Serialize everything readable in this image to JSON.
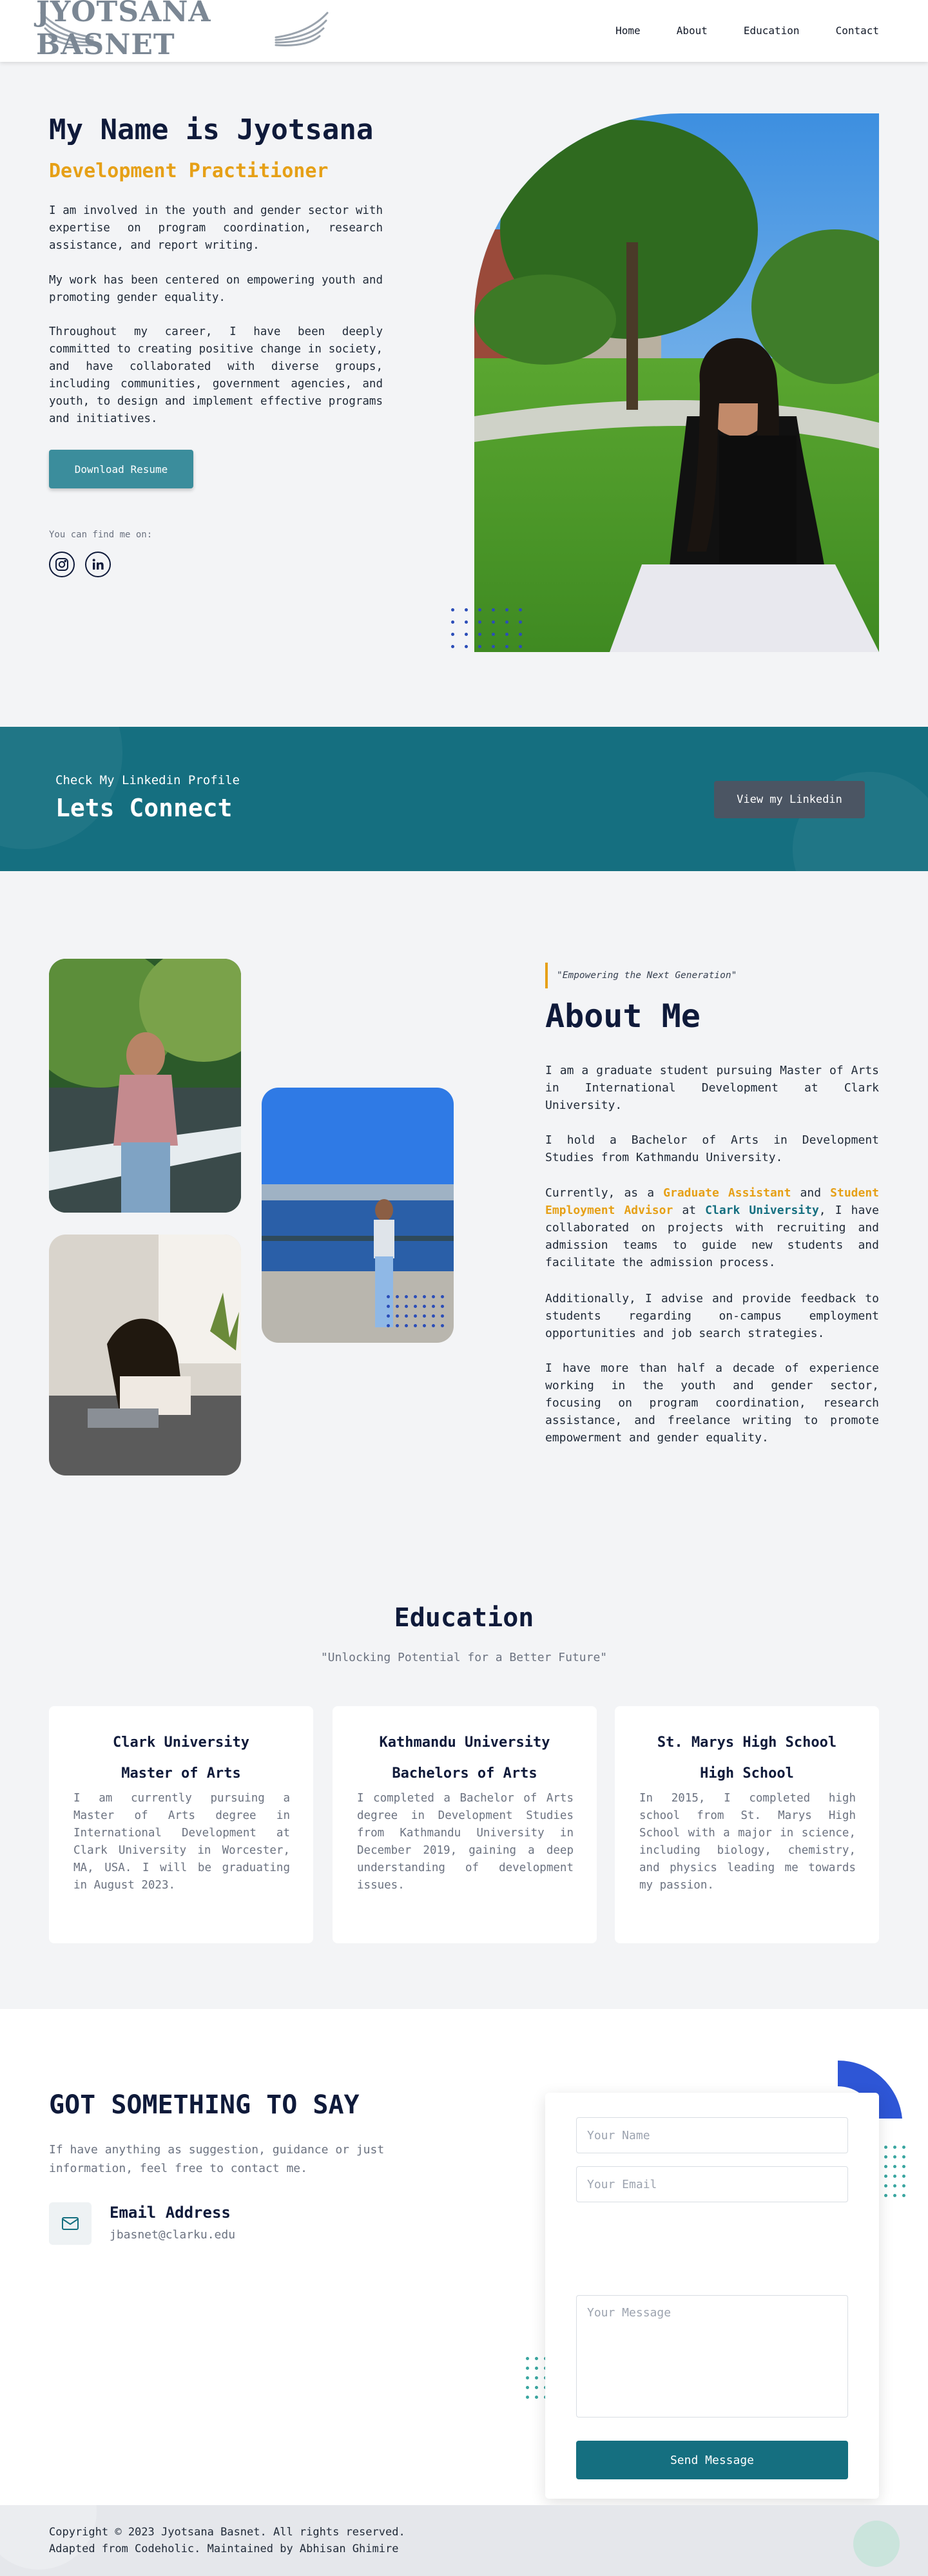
{
  "header": {
    "logo_text": "JYOTSANA BASNET",
    "nav": [
      "Home",
      "About",
      "Education",
      "Contact"
    ]
  },
  "hero": {
    "name_title": "My Name is Jyotsana",
    "subtitle": "Development Practitioner",
    "paragraphs": [
      "I am involved in the youth and gender sector with expertise on program coordination, research assistance, and report writing.",
      "My work has been centered on empowering youth and promoting gender equality.",
      "Throughout my career, I have been deeply committed to creating positive change in society, and have collaborated with diverse groups, including communities, government agencies, and youth, to design and implement effective programs and initiatives."
    ],
    "resume_button": "Download Resume",
    "find_me_label": "You can find me on:",
    "social_icons": [
      "instagram-icon",
      "linkedin-icon"
    ]
  },
  "connect": {
    "small_label": "Check My Linkedin Profile",
    "big_label": "Lets Connect",
    "button": "View my Linkedin"
  },
  "about": {
    "quote": "\"Empowering the Next Generation\"",
    "title": "About Me",
    "p1": "I am a graduate student pursuing Master of Arts in International Development at Clark University.",
    "p2": "I hold a Bachelor of Arts in Development Studies from Kathmandu University.",
    "p3_pre": "Currently, as a ",
    "p3_role1": "Graduate Assistant",
    "p3_and": " and ",
    "p3_role2": "Student Employment Advisor",
    "p3_at": " at ",
    "p3_org": "Clark University",
    "p3_post": ", I have collaborated on projects with recruiting and admission teams to guide new students and facilitate the admission process.",
    "p4": "Additionally, I advise and provide feedback to students regarding on-campus employment opportunities and job search strategies.",
    "p5": "I have more than half a decade of experience working in the youth and gender sector, focusing on program coordination, research assistance, and freelance writing to promote empowerment and gender equality."
  },
  "education": {
    "title": "Education",
    "subtitle": "\"Unlocking Potential for a Better Future\"",
    "cards": [
      {
        "school": "Clark University",
        "degree": "Master of Arts",
        "description": "I am currently pursuing a Master of Arts degree in International Development at Clark University in Worcester, MA, USA. I will be graduating in August 2023."
      },
      {
        "school": "Kathmandu University",
        "degree": "Bachelors of Arts",
        "description": "I completed a Bachelor of Arts degree in Development Studies from Kathmandu University in December 2019, gaining a deep understanding of development issues."
      },
      {
        "school": "St. Marys High School",
        "degree": "High School",
        "description": "In 2015, I completed high school from St. Marys High School with a major in science, including biology, chemistry, and physics leading me towards my passion."
      }
    ]
  },
  "contact": {
    "title": "GOT SOMETHING TO SAY",
    "subtitle": "If have anything as suggestion, guidance or just information, feel free to contact me.",
    "email_label": "Email Address",
    "email_value": "jbasnet@clarku.edu",
    "form": {
      "name_placeholder": "Your Name",
      "email_placeholder": "Your Email",
      "message_placeholder": "Your Message",
      "send_button": "Send Message"
    }
  },
  "footer": {
    "line1": "Copyright © 2023 Jyotsana Basnet. All rights reserved.",
    "line2": "Adapted from Codeholic. Maintained by Abhisan Ghimire"
  },
  "colors": {
    "accent_orange": "#e6a017",
    "teal": "#156f80",
    "navy": "#0f1a3a"
  }
}
